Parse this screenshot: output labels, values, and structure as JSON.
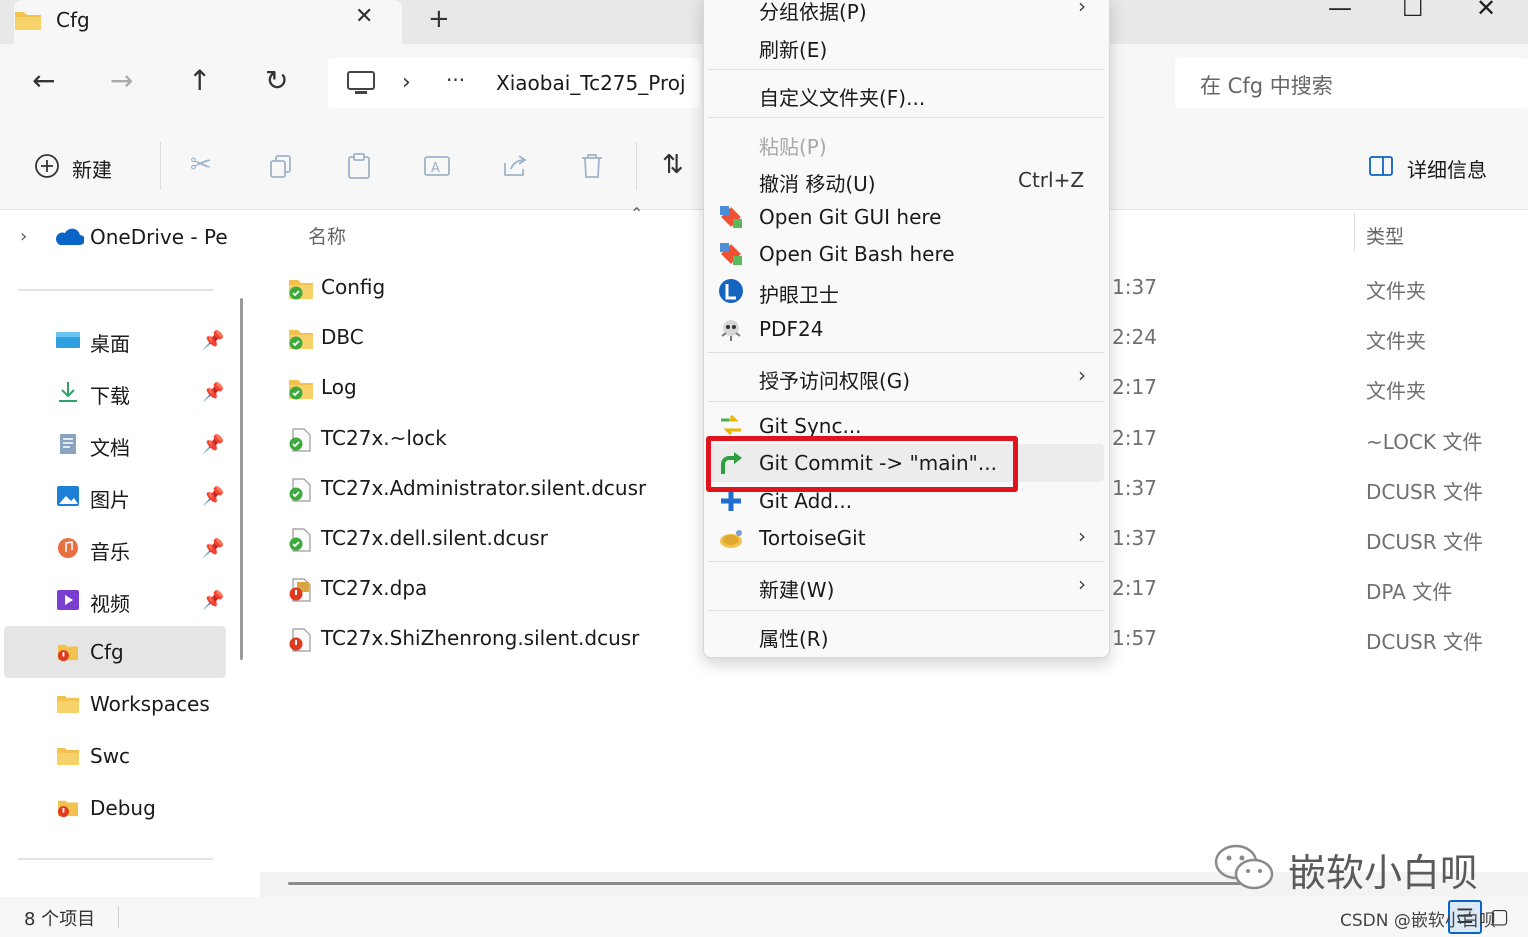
{
  "tab": {
    "title": "Cfg",
    "close": "✕",
    "new": "+"
  },
  "window": {
    "minimize": "—",
    "maximize": "☐",
    "close": "✕"
  },
  "nav": {
    "back": "←",
    "forward": "→",
    "up": "↑",
    "refresh": "↻"
  },
  "address": {
    "chevron": "›",
    "ellipsis": "···",
    "path": "Xiaobai_Tc275_Proj"
  },
  "search": {
    "placeholder": "在 Cfg 中搜索"
  },
  "toolbar": {
    "new_label": "新建",
    "details_label": "详细信息"
  },
  "sidebar": {
    "onedrive": "OneDrive - Per",
    "quick": [
      {
        "label": "桌面",
        "icon": "desktop-icon"
      },
      {
        "label": "下载",
        "icon": "download-icon"
      },
      {
        "label": "文档",
        "icon": "documents-icon"
      },
      {
        "label": "图片",
        "icon": "pictures-icon"
      },
      {
        "label": "音乐",
        "icon": "music-icon"
      },
      {
        "label": "视频",
        "icon": "videos-icon"
      }
    ],
    "folders": [
      {
        "label": "Cfg",
        "selected": true
      },
      {
        "label": "Workspaces"
      },
      {
        "label": "Swc"
      },
      {
        "label": "Debug"
      }
    ]
  },
  "filelist": {
    "header_name": "名称",
    "header_type": "类型",
    "files": [
      {
        "name": "Config",
        "time": "1:37",
        "type": "文件夹"
      },
      {
        "name": "DBC",
        "time": "2:24",
        "type": "文件夹"
      },
      {
        "name": "Log",
        "time": "2:17",
        "type": "文件夹"
      },
      {
        "name": "TC27x.~lock",
        "time": "2:17",
        "type": "~LOCK 文件"
      },
      {
        "name": "TC27x.Administrator.silent.dcusr",
        "time": "1:37",
        "type": "DCUSR 文件"
      },
      {
        "name": "TC27x.dell.silent.dcusr",
        "time": "1:37",
        "type": "DCUSR 文件"
      },
      {
        "name": "TC27x.dpa",
        "time": "2:17",
        "type": "DPA 文件"
      },
      {
        "name": "TC27x.ShiZhenrong.silent.dcusr",
        "time": "1:57",
        "type": "DCUSR 文件"
      }
    ]
  },
  "status": {
    "count": "8 个项目"
  },
  "context_menu": {
    "group_by": "分组依据(P)",
    "refresh": "刷新(E)",
    "customize": "自定义文件夹(F)...",
    "paste": "粘贴(P)",
    "undo": "撤消 移动(U)",
    "undo_shortcut": "Ctrl+Z",
    "git_gui": "Open Git GUI here",
    "git_bash": "Open Git Bash here",
    "eye_guard": "护眼卫士",
    "pdf24": "PDF24",
    "grant_access": "授予访问权限(G)",
    "git_sync": "Git Sync...",
    "git_commit": "Git Commit -> \"main\"...",
    "git_add": "Git Add...",
    "tortoisegit": "TortoiseGit",
    "new": "新建(W)",
    "properties": "属性(R)",
    "submenu_arrow": "›"
  },
  "watermark": {
    "text": "嵌软小白呗",
    "csdn": "CSDN @嵌软小白呗"
  },
  "colors": {
    "highlight_box": "#e0141e",
    "folder": "#f2c14e",
    "accent": "#0a64c8"
  }
}
